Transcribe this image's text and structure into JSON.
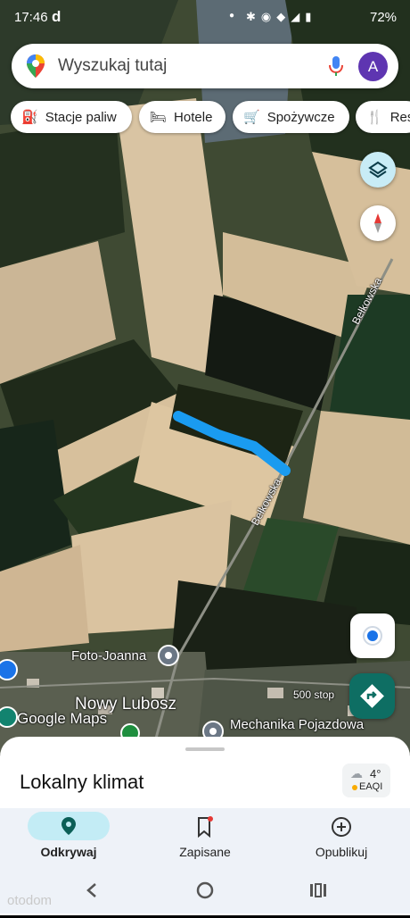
{
  "status_bar": {
    "time": "17:46",
    "app_indicator": "d",
    "battery": "72%",
    "icons": [
      "bluetooth-icon",
      "location-icon",
      "lte-icon",
      "wifi-icon",
      "signal-icon",
      "battery-icon"
    ]
  },
  "search": {
    "placeholder": "Wyszukaj tutaj",
    "avatar_letter": "A"
  },
  "chips": [
    {
      "label": "Stacje paliw",
      "icon": "gas-station-icon"
    },
    {
      "label": "Hotele",
      "icon": "hotel-icon"
    },
    {
      "label": "Spożywcze",
      "icon": "cart-icon"
    },
    {
      "label": "Res",
      "icon": "restaurant-icon"
    }
  ],
  "map": {
    "road_labels": [
      "Bełkowska",
      "Bełkowska"
    ],
    "places": {
      "foto": "Foto-Joanna",
      "town": "Nowy Lubosz",
      "mechanic": "Mechanika Pojazdowa"
    },
    "watermark": "Google Maps",
    "scale": "500 stop",
    "route_color": "#1a9bf0"
  },
  "sheet": {
    "title": "Lokalny klimat",
    "weather": {
      "temp": "4°",
      "aqi": "EAQI"
    }
  },
  "bottom_nav": [
    {
      "label": "Odkrywaj",
      "icon": "explore-pin-icon",
      "active": true
    },
    {
      "label": "Zapisane",
      "icon": "bookmark-icon",
      "active": false
    },
    {
      "label": "Opublikuj",
      "icon": "add-circle-icon",
      "active": false
    }
  ],
  "colors": {
    "accent": "#1a73e8",
    "active_tab": "#0b5f57",
    "active_pill": "#c3ecf5"
  },
  "corner_watermark": "otodom"
}
